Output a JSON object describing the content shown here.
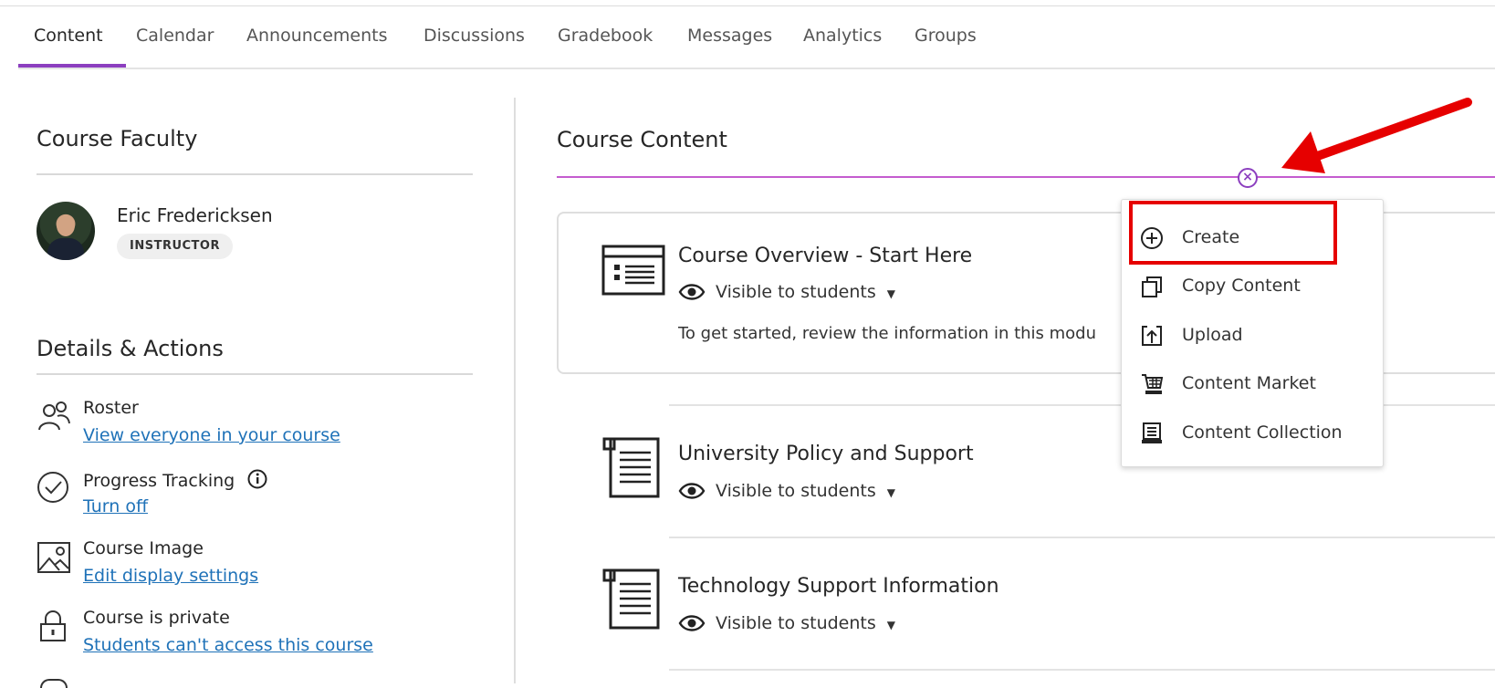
{
  "tabs": [
    "Content",
    "Calendar",
    "Announcements",
    "Discussions",
    "Gradebook",
    "Messages",
    "Analytics",
    "Groups"
  ],
  "faculty": {
    "title": "Course Faculty",
    "name": "Eric Fredericksen",
    "role": "INSTRUCTOR"
  },
  "details": {
    "title": "Details & Actions",
    "items": [
      {
        "title": "Roster",
        "link": "View everyone in your course",
        "icon": "roster-icon"
      },
      {
        "title": "Progress Tracking",
        "link": "Turn off",
        "icon": "progress-check-icon"
      },
      {
        "title": "Course Image",
        "link": "Edit display settings",
        "icon": "image-icon"
      },
      {
        "title": "Course is private",
        "link": "Students can't access this course",
        "icon": "lock-icon"
      }
    ]
  },
  "content": {
    "title": "Course Content",
    "items": [
      {
        "title": "Course Overview - Start Here",
        "visibility": "Visible to students",
        "description": "To get started, review the information in this modu"
      },
      {
        "title": "University Policy and Support",
        "visibility": "Visible to students"
      },
      {
        "title": "Technology Support Information",
        "visibility": "Visible to students"
      }
    ]
  },
  "menu": {
    "items": [
      {
        "label": "Create",
        "icon": "plus-circle-icon"
      },
      {
        "label": "Copy Content",
        "icon": "copy-icon"
      },
      {
        "label": "Upload",
        "icon": "upload-icon"
      },
      {
        "label": "Content Market",
        "icon": "cart-icon"
      },
      {
        "label": "Content Collection",
        "icon": "collection-icon"
      }
    ]
  },
  "colors": {
    "accent": "#8c3fbf",
    "link": "#1f72b8",
    "annotation": "#e60000"
  }
}
